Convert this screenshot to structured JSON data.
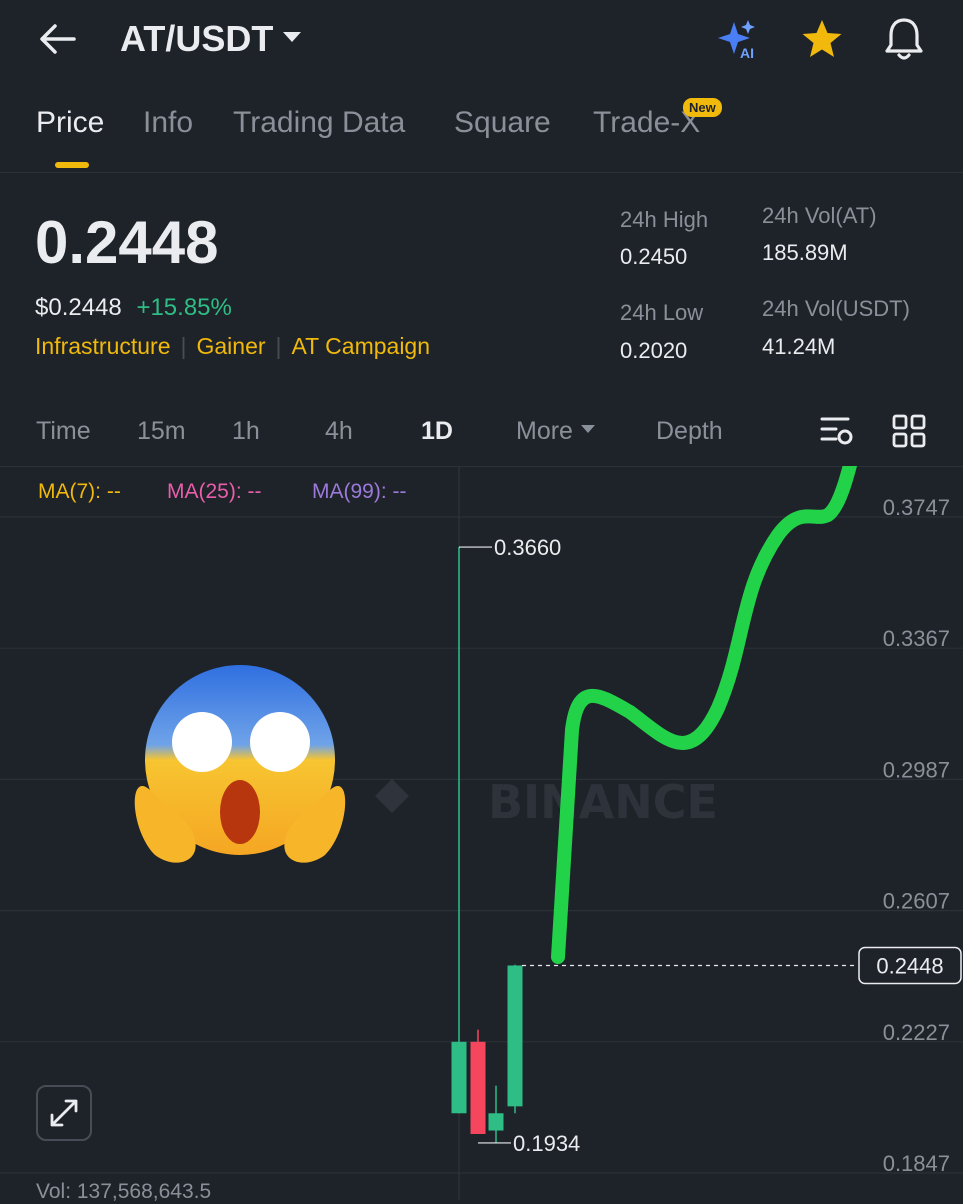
{
  "header": {
    "pair": "AT/USDT",
    "icons": [
      "back-arrow-icon",
      "ai-sparkle-icon",
      "star-icon",
      "bell-icon"
    ],
    "ai_label": "AI"
  },
  "tabs": [
    {
      "label": "Price",
      "active": true
    },
    {
      "label": "Info"
    },
    {
      "label": "Trading Data"
    },
    {
      "label": "Square"
    },
    {
      "label": "Trade-X",
      "badge": "New"
    }
  ],
  "ticker": {
    "price": "0.2448",
    "usd_price": "$0.2448",
    "change": "+15.85%",
    "tags": [
      "Infrastructure",
      "Gainer",
      "AT Campaign"
    ],
    "high_label": "24h High",
    "high_value": "0.2450",
    "low_label": "24h Low",
    "low_value": "0.2020",
    "vol_at_label": "24h Vol(AT)",
    "vol_at_value": "185.89M",
    "vol_usdt_label": "24h Vol(USDT)",
    "vol_usdt_value": "41.24M"
  },
  "intervals": {
    "items": [
      "Time",
      "15m",
      "1h",
      "4h",
      "1D",
      "More",
      "Depth"
    ],
    "active": "1D"
  },
  "indicators": {
    "ma7": "MA(7): --",
    "ma25": "MA(25): --",
    "ma99": "MA(99): --"
  },
  "chart_data": {
    "type": "candlestick",
    "watermark": "BINANCE",
    "y_ticks": [
      "0.3747",
      "0.3367",
      "0.2987",
      "0.2607",
      "0.2227",
      "0.1847"
    ],
    "y_range": [
      0.1847,
      0.3747
    ],
    "current_price": "0.2448",
    "high_annotation": "0.3660",
    "low_annotation": "0.1934",
    "candles": [
      {
        "open": 0.2227,
        "close": 0.202,
        "high": 0.366,
        "low": 0.202,
        "direction": "up"
      },
      {
        "open": 0.2227,
        "close": 0.196,
        "high": 0.2262,
        "low": 0.196,
        "direction": "down"
      },
      {
        "open": 0.197,
        "close": 0.202,
        "high": 0.21,
        "low": 0.1934,
        "direction": "up"
      },
      {
        "open": 0.204,
        "close": 0.2448,
        "high": 0.245,
        "low": 0.202,
        "direction": "up"
      }
    ],
    "colors": {
      "up": "#2ebd85",
      "down": "#f6465d",
      "overlay": "#22d34a"
    }
  },
  "footer": {
    "vol": "Vol: 137,568,643.5"
  },
  "colors": {
    "accent": "#f0b90b",
    "up": "#2ebd85",
    "down": "#f6465d",
    "bg": "#1e2229"
  }
}
